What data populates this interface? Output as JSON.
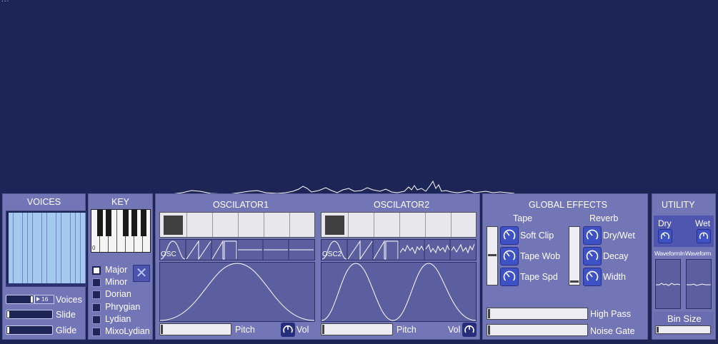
{
  "corner_text": "...",
  "voices": {
    "title": "VOICES",
    "bar_count": 16,
    "count_value": "16",
    "count_label": "Voices",
    "slide_label": "Slide",
    "glide_label": "Glide"
  },
  "key": {
    "title": "KEY",
    "octave": "0",
    "scales": [
      {
        "label": "Major",
        "checked": true
      },
      {
        "label": "Minor",
        "checked": false
      },
      {
        "label": "Dorian",
        "checked": false
      },
      {
        "label": "Phrygian",
        "checked": false
      },
      {
        "label": "Lydian",
        "checked": false
      },
      {
        "label": "MixoLydian",
        "checked": false
      }
    ],
    "clear_glyph": "✕"
  },
  "osc1": {
    "title": "OSCILATOR1",
    "wave_tag": "OSC",
    "pitch_label": "Pitch",
    "vol_label": "Vol"
  },
  "osc2": {
    "title": "OSCILATOR2",
    "wave_tag": "OSC2",
    "pitch_label": "Pitch",
    "vol_label": "Vol"
  },
  "global_effects": {
    "title": "GLOBAL EFFECTS",
    "tape": {
      "title": "Tape",
      "knobs": [
        "Soft Clip",
        "Tape Wob",
        "Tape Spd"
      ]
    },
    "reverb": {
      "title": "Reverb",
      "knobs": [
        "Dry/Wet",
        "Decay",
        "Width"
      ]
    },
    "high_pass_label": "High Pass",
    "noise_gate_label": "Noise Gate"
  },
  "utility": {
    "title": "UTILITY",
    "dry_label": "Dry",
    "wet_label": "Wet",
    "waveform_in_label": "WaveformIn",
    "waveform_label": "Waveform",
    "bin_size_label": "Bin Size"
  },
  "colors": {
    "background": "#1d2556",
    "panel": "#7275b6",
    "voice_bar": "#a4c8ee",
    "knob": "#3e52c6"
  }
}
